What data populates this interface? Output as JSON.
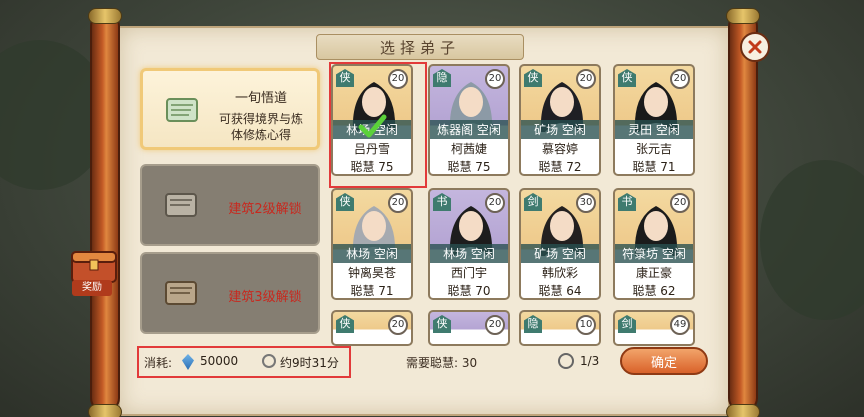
{
  "title": "选择弟子",
  "left_cards": [
    {
      "title": "一旬悟道",
      "desc_line1": "可获得境界与炼",
      "desc_line2": "体修炼心得",
      "locked": false
    },
    {
      "locked_text": "建筑2级解锁",
      "locked": true
    },
    {
      "locked_text": "建筑3级解锁",
      "locked": true
    }
  ],
  "reward_label": "奖励",
  "disciples": [
    {
      "rank": "侠",
      "level": "20",
      "status": "林场 空闲",
      "name": "吕丹雪",
      "wisdom": "聪慧 75",
      "bg": "gold",
      "selected": true
    },
    {
      "rank": "隐",
      "level": "20",
      "status": "炼器阁 空闲",
      "name": "柯茜婕",
      "wisdom": "聪慧 75",
      "bg": "purple",
      "selected": false
    },
    {
      "rank": "侠",
      "level": "20",
      "status": "矿场 空闲",
      "name": "慕容婷",
      "wisdom": "聪慧 72",
      "bg": "gold",
      "selected": false
    },
    {
      "rank": "侠",
      "level": "20",
      "status": "灵田 空闲",
      "name": "张元吉",
      "wisdom": "聪慧 71",
      "bg": "gold",
      "selected": false
    },
    {
      "rank": "侠",
      "level": "20",
      "status": "林场 空闲",
      "name": "钟离昊苍",
      "wisdom": "聪慧 71",
      "bg": "gold",
      "selected": false
    },
    {
      "rank": "书",
      "level": "20",
      "status": "林场 空闲",
      "name": "西门宇",
      "wisdom": "聪慧 70",
      "bg": "purple",
      "selected": false
    },
    {
      "rank": "剑",
      "level": "30",
      "status": "矿场 空闲",
      "name": "韩欣彩",
      "wisdom": "聪慧 64",
      "bg": "gold",
      "selected": false
    },
    {
      "rank": "书",
      "level": "20",
      "status": "符箓坊 空闲",
      "name": "康正豪",
      "wisdom": "聪慧 62",
      "bg": "gold",
      "selected": false
    }
  ],
  "partial_row": [
    {
      "rank": "侠",
      "level": "20",
      "bg": "gold"
    },
    {
      "rank": "侠",
      "level": "20",
      "bg": "purple"
    },
    {
      "rank": "隐",
      "level": "10",
      "bg": "gold"
    },
    {
      "rank": "剑",
      "level": "49",
      "bg": "gold"
    }
  ],
  "bottom": {
    "cost_label": "消耗:",
    "cost_value": "50000",
    "time_value": "约9时31分",
    "need_label": "需要聪慧:",
    "need_value": "30",
    "count": "1/3",
    "confirm_label": "确定"
  },
  "colors": {
    "highlight": "#e23a3a",
    "accent": "#d9622a",
    "locked_text": "#c8281e"
  }
}
